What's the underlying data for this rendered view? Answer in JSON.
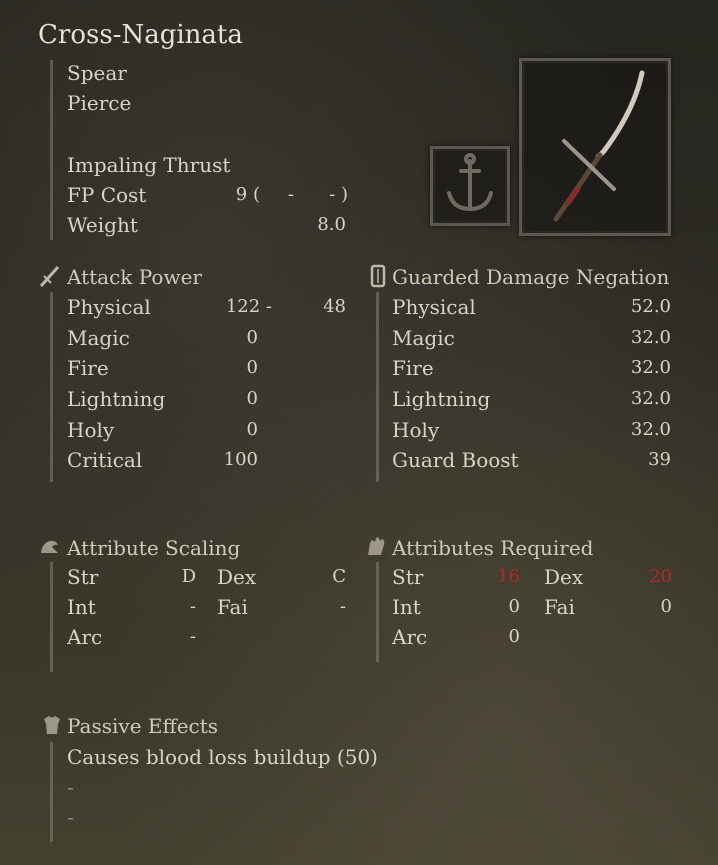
{
  "weapon": {
    "name": "Cross-Naginata",
    "type": "Spear",
    "damage_type": "Pierce",
    "skill": "Impaling Thrust",
    "fp_cost_label": "FP Cost",
    "fp_cost_values": [
      "9 (",
      "-",
      "- )"
    ],
    "weight_label": "Weight",
    "weight_value": "8.0"
  },
  "attack_power": {
    "heading": "Attack Power",
    "rows": [
      {
        "label": "Physical",
        "value": "122 -",
        "extra": "48"
      },
      {
        "label": "Magic",
        "value": "0"
      },
      {
        "label": "Fire",
        "value": "0"
      },
      {
        "label": "Lightning",
        "value": "0"
      },
      {
        "label": "Holy",
        "value": "0"
      },
      {
        "label": "Critical",
        "value": "100"
      }
    ]
  },
  "guarded": {
    "heading": "Guarded Damage Negation",
    "rows": [
      {
        "label": "Physical",
        "value": "52.0"
      },
      {
        "label": "Magic",
        "value": "32.0"
      },
      {
        "label": "Fire",
        "value": "32.0"
      },
      {
        "label": "Lightning",
        "value": "32.0"
      },
      {
        "label": "Holy",
        "value": "32.0"
      },
      {
        "label": "Guard Boost",
        "value": "39"
      }
    ]
  },
  "scaling": {
    "heading": "Attribute Scaling",
    "str": {
      "label": "Str",
      "value": "D"
    },
    "dex": {
      "label": "Dex",
      "value": "C"
    },
    "int": {
      "label": "Int",
      "value": "-"
    },
    "fai": {
      "label": "Fai",
      "value": "-"
    },
    "arc": {
      "label": "Arc",
      "value": "-"
    }
  },
  "required": {
    "heading": "Attributes Required",
    "str": {
      "label": "Str",
      "value": "16"
    },
    "dex": {
      "label": "Dex",
      "value": "20"
    },
    "int": {
      "label": "Int",
      "value": "0"
    },
    "fai": {
      "label": "Fai",
      "value": "0"
    },
    "arc": {
      "label": "Arc",
      "value": "0"
    }
  },
  "passive": {
    "heading": "Passive Effects",
    "lines": [
      "Causes blood loss buildup (50)",
      "-",
      "-"
    ]
  },
  "icons": {
    "attack": "sword-icon",
    "guard": "shield-icon",
    "scaling": "arm-icon",
    "required": "hand-icon",
    "passive": "armor-icon",
    "affinity": "anchor-icon"
  },
  "colors": {
    "text": "#d9d4c6",
    "insufficient": "#b32828"
  }
}
